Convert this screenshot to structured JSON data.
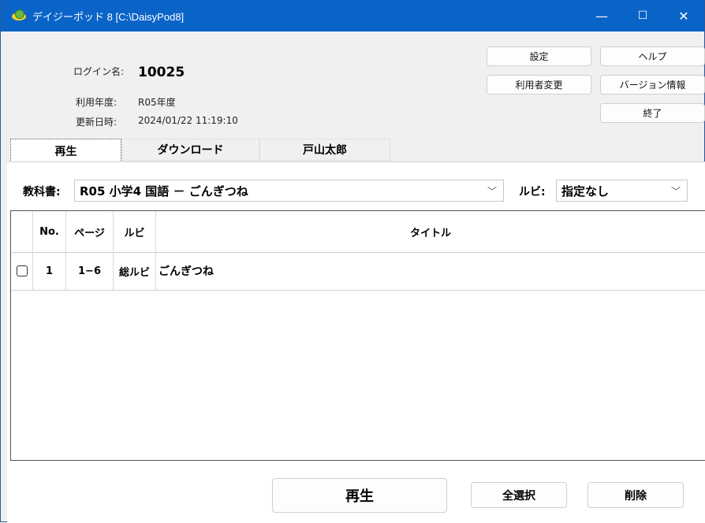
{
  "window": {
    "title": "デイジーポッド 8  [C:\\DaisyPod8]",
    "controls": {
      "minimize": "—",
      "maximize": "☐",
      "close": "✕"
    }
  },
  "header": {
    "login_label": "ログイン名:",
    "login_value": "10025",
    "year_label": "利用年度:",
    "year_value": "R05年度",
    "updated_label": "更新日時:",
    "updated_value": "2024/01/22 11:19:10"
  },
  "buttons": {
    "settings": "設定",
    "help": "ヘルプ",
    "change_user": "利用者変更",
    "version_info": "バージョン情報",
    "exit": "終了"
  },
  "tabs": [
    {
      "label": "再生",
      "active": true
    },
    {
      "label": "ダウンロード",
      "active": false
    },
    {
      "label": "戸山太郎",
      "active": false
    }
  ],
  "selectors": {
    "textbook_label": "教科書:",
    "textbook_value": "R05  小学4  国語  －  ごんぎつね",
    "ruby_label": "ルビ:",
    "ruby_value": "指定なし",
    "chevron": "﹀"
  },
  "table": {
    "columns": [
      "",
      "No.",
      "ページ",
      "ルビ",
      "タイトル"
    ],
    "rows": [
      {
        "checked": false,
        "no": "1",
        "page": "1−6",
        "ruby": "総ルビ",
        "title": "ごんぎつね"
      }
    ]
  },
  "footer": {
    "play": "再生",
    "select_all": "全選択",
    "delete": "削除"
  },
  "colors": {
    "titlebar": "#0a64c8",
    "background": "#f0f0f0"
  }
}
